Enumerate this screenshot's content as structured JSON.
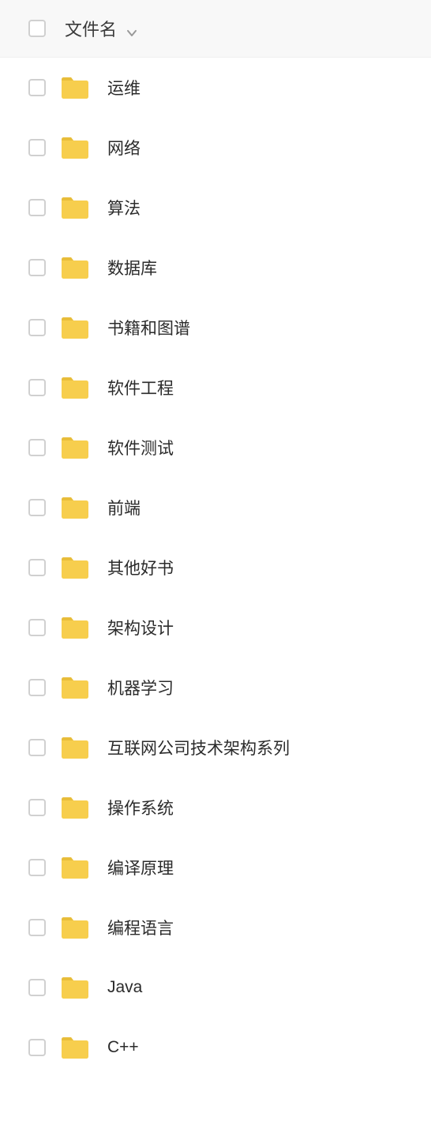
{
  "header": {
    "column_label": "文件名"
  },
  "files": [
    {
      "name": "运维"
    },
    {
      "name": "网络"
    },
    {
      "name": "算法"
    },
    {
      "name": "数据库"
    },
    {
      "name": "书籍和图谱"
    },
    {
      "name": "软件工程"
    },
    {
      "name": "软件测试"
    },
    {
      "name": "前端"
    },
    {
      "name": "其他好书"
    },
    {
      "name": "架构设计"
    },
    {
      "name": "机器学习"
    },
    {
      "name": "互联网公司技术架构系列"
    },
    {
      "name": "操作系统"
    },
    {
      "name": "编译原理"
    },
    {
      "name": "编程语言"
    },
    {
      "name": "Java"
    },
    {
      "name": "C++"
    }
  ]
}
